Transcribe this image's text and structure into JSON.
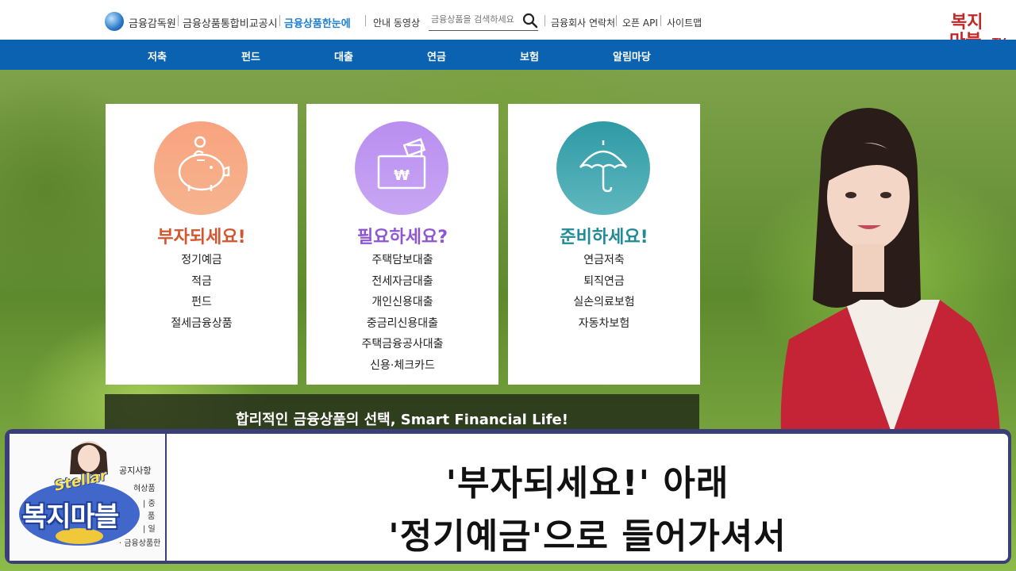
{
  "header": {
    "brand_org": "금융감독원",
    "brand_service": "금융상품통합비교공시",
    "brand_site": "금융상품한눈에",
    "guide_video": "안내 동영상",
    "search_placeholder": "금융상품을 검색하세요",
    "company_contacts": "금융회사 연락처",
    "open_api": "오픈 API",
    "sitemap": "사이트맵"
  },
  "channel_logo": {
    "line1": "복지",
    "line2": "마블",
    "tv": "TV"
  },
  "nav": [
    "저축",
    "펀드",
    "대출",
    "연금",
    "보험",
    "알림마당"
  ],
  "cards": [
    {
      "title": "부자되세요!",
      "items": [
        "정기예금",
        "적금",
        "펀드",
        "절세금융상품"
      ]
    },
    {
      "title": "필요하세요?",
      "items": [
        "주택담보대출",
        "전세자금대출",
        "개인신용대출",
        "중금리신용대출",
        "주택금융공사대출",
        "신용·체크카드"
      ]
    },
    {
      "title": "준비하세요!",
      "items": [
        "연금저축",
        "퇴직연금",
        "실손의료보험",
        "자동차보험"
      ]
    }
  ],
  "slogan": "합리적인 금융상품의 선택, Smart Financial Life!",
  "notice": {
    "title": "공지사항",
    "lines": [
      "혀상품",
      "| 중",
      "품",
      "| 일",
      "· 금융상품한"
    ]
  },
  "badge": {
    "stellar": "Stellar",
    "name": "복지마블"
  },
  "subtitle": {
    "line1": "'부자되세요!' 아래",
    "line2": "'정기예금'으로 들어가셔서"
  },
  "colors": {
    "nav_bg": "#0a62b0",
    "save_accent": "#d6552d",
    "loan_accent": "#8f56d4",
    "prepare_accent": "#1f8b96",
    "subtitle_frame": "#3a3f7a"
  }
}
